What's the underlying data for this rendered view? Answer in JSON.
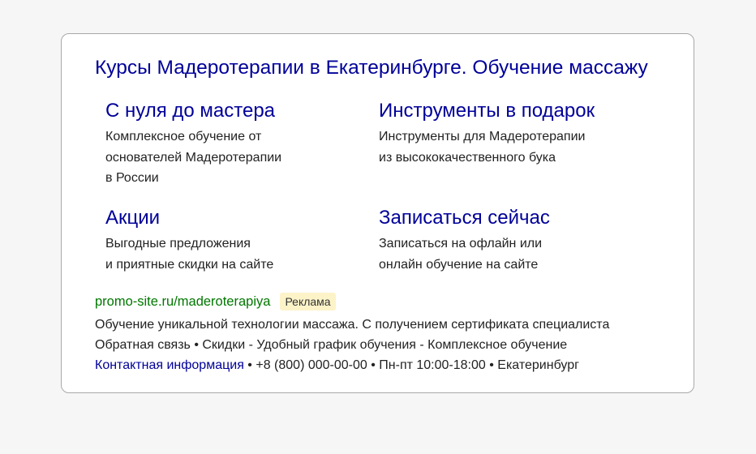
{
  "ad": {
    "title": "Курсы Мадеротерапии в Екатеринбурге. Обучение массажу",
    "sitelinks": [
      {
        "title": "С нуля до мастера",
        "desc": "Комплексное обучение от\nоснователей Мадеротерапии\nв России"
      },
      {
        "title": "Инструменты в подарок",
        "desc": "Инструменты для Мадеротерапии\nиз высококачественного бука"
      },
      {
        "title": "Акции",
        "desc": "Выгодные предложения\nи приятные скидки на сайте"
      },
      {
        "title": "Записаться сейчас",
        "desc": "Записаться на офлайн или\nонлайн обучение на сайте"
      }
    ],
    "url": "promo-site.ru/maderoterapiya",
    "badge": "Реклама",
    "text1": "Обучение уникальной технологии массажа. С получением сертификата специалиста",
    "text2": "Обратная связь • Скидки - Удобный график обучения - Комплексное обучение",
    "contact_link": "Контактная информация",
    "contact_rest": " • +8 (800) 000-00-00 • Пн-пт 10:00-18:00 • Екатеринбург"
  }
}
